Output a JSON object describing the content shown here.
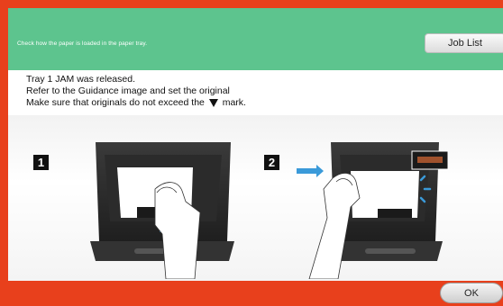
{
  "header": {
    "message": "Check how the paper is loaded in the paper tray.",
    "job_list_label": "Job List"
  },
  "message": {
    "line1": "Tray 1 JAM was released.",
    "line2": "Refer to the Guidance image and set the original",
    "line3_before": "Make sure that originals do not exceed the",
    "line3_after": "mark."
  },
  "guidance": {
    "step1": "1",
    "step2": "2"
  },
  "footer": {
    "ok_label": "OK"
  },
  "colors": {
    "frame": "#e8401c",
    "header": "#5dc48e",
    "arrow": "#3a9ad9"
  }
}
